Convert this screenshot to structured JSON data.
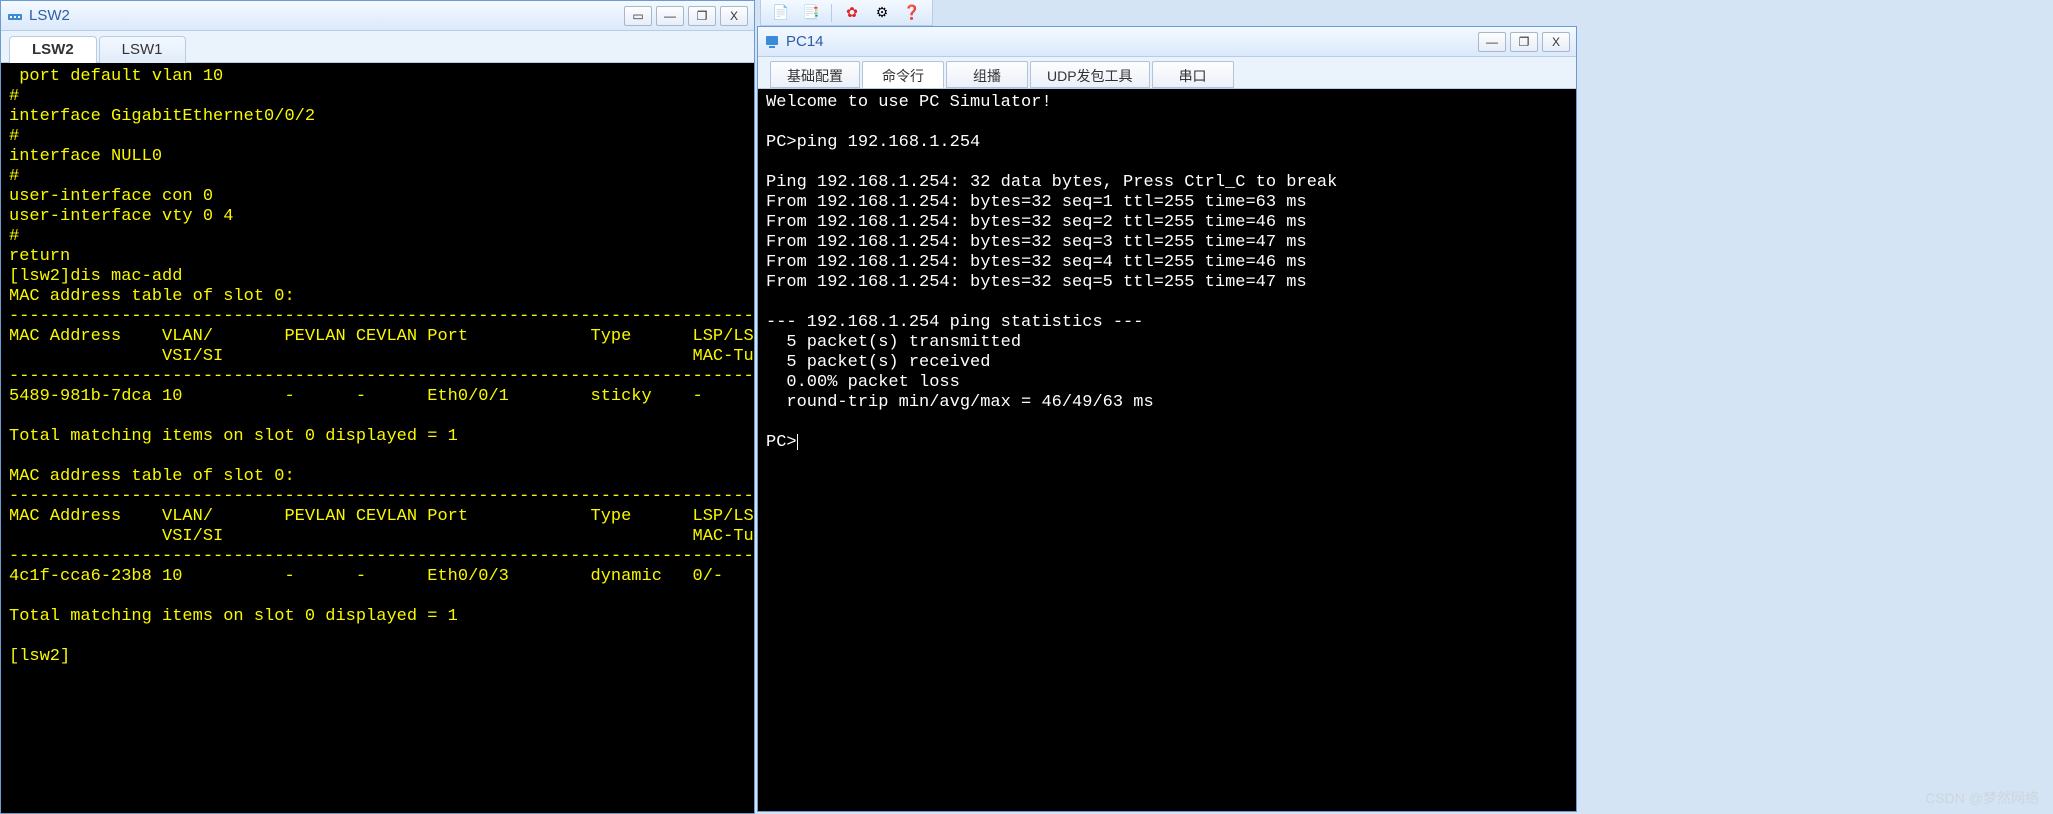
{
  "toolbar_top": {
    "icons": [
      "doc-icon",
      "doc-pair-icon",
      "flower-icon",
      "gear-icon",
      "help-icon"
    ]
  },
  "left_window": {
    "title": "LSW2",
    "win_buttons": {
      "menu": "▭",
      "min": "—",
      "restore": "❐",
      "close": "X"
    },
    "tabs": [
      {
        "label": "LSW2",
        "active": true
      },
      {
        "label": "LSW1",
        "active": false
      }
    ],
    "terminal_lines": [
      " port default vlan 10",
      "#",
      "interface GigabitEthernet0/0/2",
      "#",
      "interface NULL0",
      "#",
      "user-interface con 0",
      "user-interface vty 0 4",
      "#",
      "return",
      "[lsw2]dis mac-add",
      "MAC address table of slot 0:",
      "-------------------------------------------------------------------------------",
      "MAC Address    VLAN/       PEVLAN CEVLAN Port            Type      LSP/LSR-ID  ",
      "               VSI/SI                                              MAC-Tunnel  ",
      "-------------------------------------------------------------------------------",
      "5489-981b-7dca 10          -      -      Eth0/0/1        sticky    -           ",
      "",
      "Total matching items on slot 0 displayed = 1",
      "",
      "MAC address table of slot 0:",
      "-------------------------------------------------------------------------------",
      "MAC Address    VLAN/       PEVLAN CEVLAN Port            Type      LSP/LSR-ID  ",
      "               VSI/SI                                              MAC-Tunnel  ",
      "-------------------------------------------------------------------------------",
      "4c1f-cca6-23b8 10          -      -      Eth0/0/3        dynamic   0/-         ",
      "",
      "Total matching items on slot 0 displayed = 1",
      "",
      "[lsw2]"
    ]
  },
  "right_window": {
    "title": "PC14",
    "win_buttons": {
      "min": "—",
      "restore": "❐",
      "close": "X"
    },
    "sub_tabs": [
      {
        "label": "基础配置",
        "active": false
      },
      {
        "label": "命令行",
        "active": true
      },
      {
        "label": "组播",
        "active": false
      },
      {
        "label": "UDP发包工具",
        "active": false
      },
      {
        "label": "串口",
        "active": false
      }
    ],
    "terminal_lines": [
      "Welcome to use PC Simulator!",
      "",
      "PC>ping 192.168.1.254",
      "",
      "Ping 192.168.1.254: 32 data bytes, Press Ctrl_C to break",
      "From 192.168.1.254: bytes=32 seq=1 ttl=255 time=63 ms",
      "From 192.168.1.254: bytes=32 seq=2 ttl=255 time=46 ms",
      "From 192.168.1.254: bytes=32 seq=3 ttl=255 time=47 ms",
      "From 192.168.1.254: bytes=32 seq=4 ttl=255 time=46 ms",
      "From 192.168.1.254: bytes=32 seq=5 ttl=255 time=47 ms",
      "",
      "--- 192.168.1.254 ping statistics ---",
      "  5 packet(s) transmitted",
      "  5 packet(s) received",
      "  0.00% packet loss",
      "  round-trip min/avg/max = 46/49/63 ms",
      "",
      "PC>"
    ]
  },
  "watermark": "CSDN @梦然网络"
}
